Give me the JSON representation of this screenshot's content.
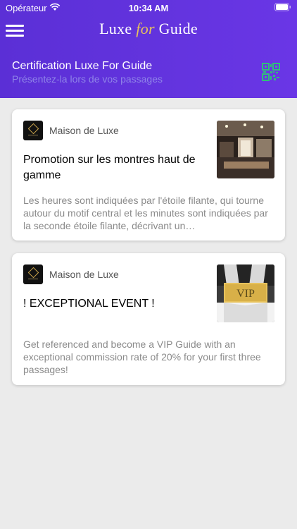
{
  "status": {
    "carrier": "Opérateur",
    "time": "10:34 AM"
  },
  "header": {
    "logo_left": "Luxe",
    "logo_mid": "for",
    "logo_right": "Guide",
    "cert_title": "Certification Luxe For Guide",
    "cert_subtitle": "Présentez-la lors de vos passages"
  },
  "cards": [
    {
      "brand": "Maison de Luxe",
      "title": "Promotion sur les montres haut de gamme",
      "description": "Les heures sont indiquées par l'étoile filante, qui tourne autour du motif central et les minutes sont indiquées par la seconde étoile filante, décrivant un…"
    },
    {
      "brand": "Maison de Luxe",
      "title": "! EXCEPTIONAL EVENT !",
      "description": "Get referenced and become a VIP Guide with an exceptional commission rate of 20% for your first three passages!",
      "thumb_text": "VIP"
    }
  ],
  "colors": {
    "header": "#6233dd",
    "accent": "#e7c25c",
    "qr": "#2fbf7a"
  },
  "icons": [
    "menu-icon",
    "qr-code-icon",
    "wifi-icon",
    "battery-icon"
  ]
}
